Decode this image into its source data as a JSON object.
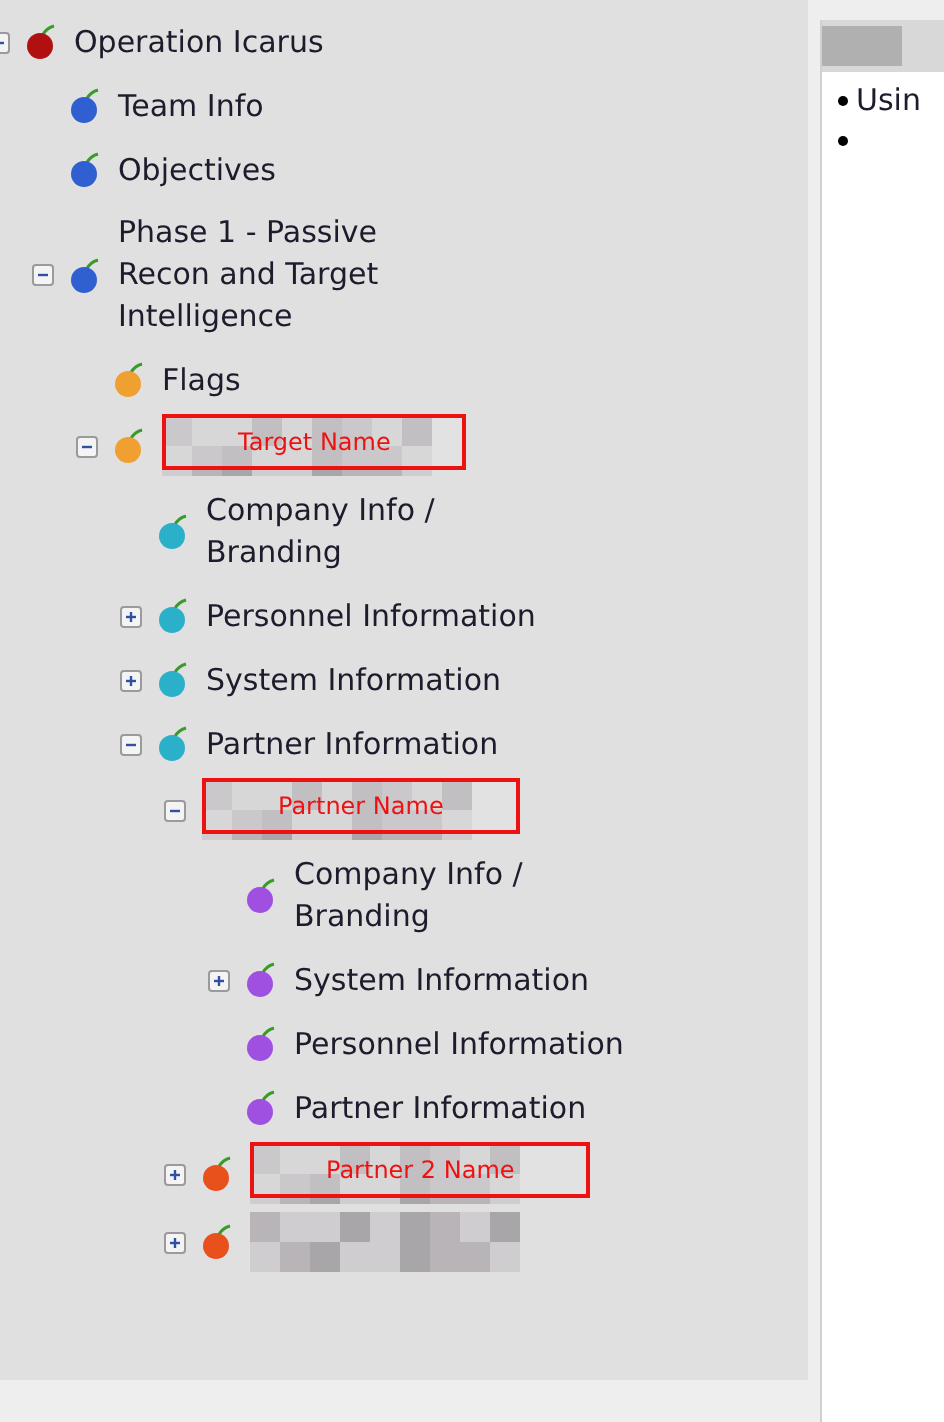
{
  "tree": [
    {
      "label": "Operation Icarus",
      "color": "#b01010",
      "expanded": true,
      "children": [
        {
          "label": "Team Info",
          "color": "#2f5fd0"
        },
        {
          "label": "Objectives",
          "color": "#2f5fd0"
        },
        {
          "label": "Phase 1 - Passive\nRecon and Target\nIntelligence",
          "color": "#2f5fd0",
          "expanded": true,
          "children": [
            {
              "label": "Flags",
              "color": "#f0a030"
            },
            {
              "redacted": true,
              "annotation": "Target Name",
              "color": "#f0a030",
              "expanded": true,
              "children": [
                {
                  "label": "Company Info /\nBranding",
                  "color": "#2ab0c8"
                },
                {
                  "label": "Personnel Information",
                  "color": "#2ab0c8",
                  "expanded": false
                },
                {
                  "label": "System Information",
                  "color": "#2ab0c8",
                  "expanded": false
                },
                {
                  "label": "Partner Information",
                  "color": "#2ab0c8",
                  "expanded": true,
                  "children": [
                    {
                      "redacted": true,
                      "annotation": "Partner Name",
                      "expanded": true,
                      "children": [
                        {
                          "label": "Company Info /\nBranding",
                          "color": "#a050e0"
                        },
                        {
                          "label": "System Information",
                          "color": "#a050e0",
                          "expanded": false
                        },
                        {
                          "label": "Personnel Information",
                          "color": "#a050e0"
                        },
                        {
                          "label": "Partner Information",
                          "color": "#a050e0"
                        }
                      ]
                    },
                    {
                      "redacted": true,
                      "annotation": "Partner 2 Name",
                      "color": "#e8501c",
                      "expanded": false
                    },
                    {
                      "redacted": true,
                      "color": "#e8501c",
                      "expanded": false
                    }
                  ]
                }
              ]
            }
          ]
        }
      ]
    }
  ],
  "content": {
    "header_redacted": true,
    "bullets": [
      {
        "kind": "text",
        "text": "Usin"
      },
      {
        "kind": "empty"
      }
    ]
  }
}
